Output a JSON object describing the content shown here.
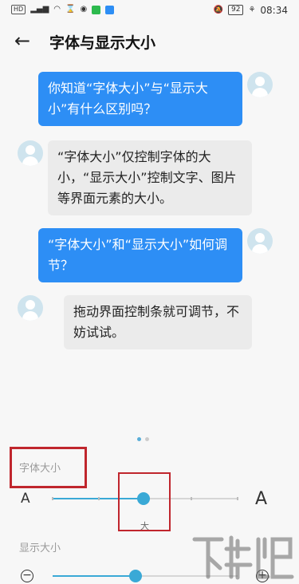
{
  "status_bar": {
    "time": "08:34",
    "battery": "92",
    "hd": "HD",
    "signal": "4G"
  },
  "header": {
    "back_icon": "←",
    "title": "字体与显示大小"
  },
  "chat": [
    {
      "from": "user",
      "text": "你知道“字体大小”与“显示大小”有什么区别吗？"
    },
    {
      "from": "bot",
      "text": "“字体大小”仅控制字体的大小，“显示大小”控制文字、图片等界面元素的大小。"
    },
    {
      "from": "user",
      "text": "“字体大小”和“显示大小”如何调节？"
    },
    {
      "from": "bot",
      "text": "拖动界面控制条就可调节，不妨试试。"
    }
  ],
  "page_dots": {
    "count": 2,
    "active": 0
  },
  "font_size": {
    "label": "字体大小",
    "small_icon": "A",
    "large_icon": "A",
    "current_label": "大",
    "level_fraction": 0.49,
    "steps": 5
  },
  "display_size": {
    "label": "显示大小",
    "minus_icon": "−",
    "plus_icon": "+",
    "level_fraction": 0.45
  },
  "colors": {
    "accent": "#3aa9d6",
    "user_bubble": "#2d8ef5",
    "bot_bubble": "#ebebeb",
    "highlight": "#c0262d"
  }
}
